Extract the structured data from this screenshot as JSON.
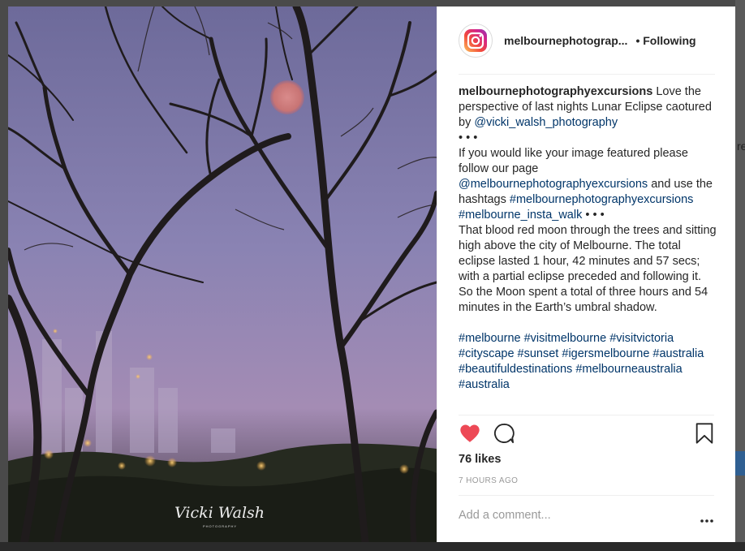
{
  "post": {
    "username": "melbournephotograp...",
    "follow_status": "• Following",
    "caption": {
      "username": "melbournephotographyexcursions",
      "text1": " Love the perspective of last nights Lunar Eclipse caotured by ",
      "mention1": "@vicki_walsh_photography",
      "dots1": "• • •",
      "text2": "If you would like your image featured please follow our page ",
      "mention2": "@melbournephotographyexcursions",
      "text3": " and use the hashtags ",
      "hashtag1": "#melbournephotographyexcursions",
      "hashtag2": "#melbourne_insta_walk",
      "dots2": " • • •",
      "text4": "That blood red moon through the trees and sitting high above the city of Melbourne. The total eclipse lasted 1 hour, 42 minutes and 57 secs; with a partial eclipse preceded and following it. So the Moon spent a total of three hours and 54 minutes in the Earth’s umbral shadow.",
      "hashtags": [
        "#melbourne",
        "#visitmelbourne",
        "#visitvictoria",
        "#cityscape",
        "#sunset",
        "#igersmelbourne",
        "#australia",
        "#beautifuldestinations",
        "#melbourneaustralia",
        "#australia"
      ]
    },
    "likes": "76 likes",
    "timestamp": "7 HOURS AGO",
    "comment_placeholder": "Add a comment...",
    "photo_watermark": "Vicki Walsh",
    "photo_watermark_sub": "PHOTOGRAPHY"
  },
  "background": {
    "fragment": "re"
  },
  "icons": {
    "avatar": "instagram-logo-icon",
    "like": "heart-filled-icon",
    "comment": "speech-bubble-icon",
    "save": "bookmark-icon",
    "more": "ellipsis-icon"
  },
  "colors": {
    "heart": "#ed4956",
    "link": "#003569",
    "muted": "#999999"
  }
}
